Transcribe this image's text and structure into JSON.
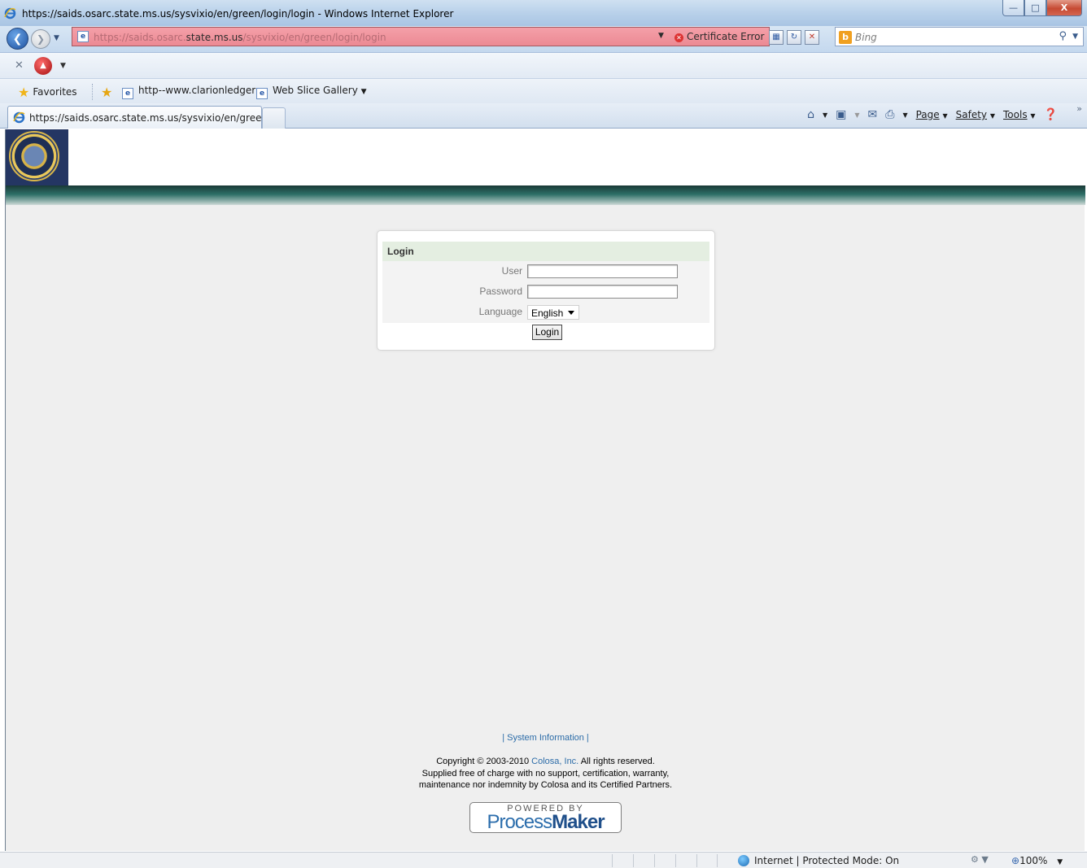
{
  "window": {
    "title": "https://saids.osarc.state.ms.us/sysvixio/en/green/login/login - Windows Internet Explorer",
    "minimize_icon": "minimize-icon",
    "maximize_icon": "maximize-icon",
    "close_icon": "close-icon"
  },
  "address_bar": {
    "url_prefix": "https://saids.osarc.",
    "url_domain": "state.ms.us",
    "url_suffix": "/sysvixio/en/green/login/login",
    "certificate_error": "Certificate Error"
  },
  "search": {
    "placeholder": "Bing"
  },
  "favorites_bar": {
    "favorites_label": "Favorites",
    "items": [
      {
        "label": "http--www.clarionledger"
      },
      {
        "label": "Web Slice Gallery"
      }
    ]
  },
  "tabs": [
    {
      "label": "https://saids.osarc.state.ms.us/sysvixio/en/green..."
    }
  ],
  "command_bar": {
    "page": "Page",
    "safety": "Safety",
    "tools": "Tools"
  },
  "login": {
    "title": "Login",
    "user_label": "User",
    "password_label": "Password",
    "language_label": "Language",
    "language_value": "English",
    "button_label": "Login"
  },
  "footer": {
    "system_info": "| System Information |",
    "copyright_prefix": "Copyright © 2003-2010 ",
    "company_link": "Colosa, Inc.",
    "copyright_suffix": " All rights reserved.",
    "line2": "Supplied free of charge with no support, certification, warranty,",
    "line3": "maintenance nor indemnity by Colosa and its Certified Partners.",
    "powered_by": "POWERED BY",
    "brand_light": "Process",
    "brand_bold": "Maker"
  },
  "status_bar": {
    "zone": "Internet | Protected Mode: On",
    "zoom": "100%"
  },
  "colors": {
    "address_error": "#ec8a94",
    "header_bar": "#2d6e66",
    "login_header": "#e4eee1",
    "link": "#2c6ca8"
  }
}
